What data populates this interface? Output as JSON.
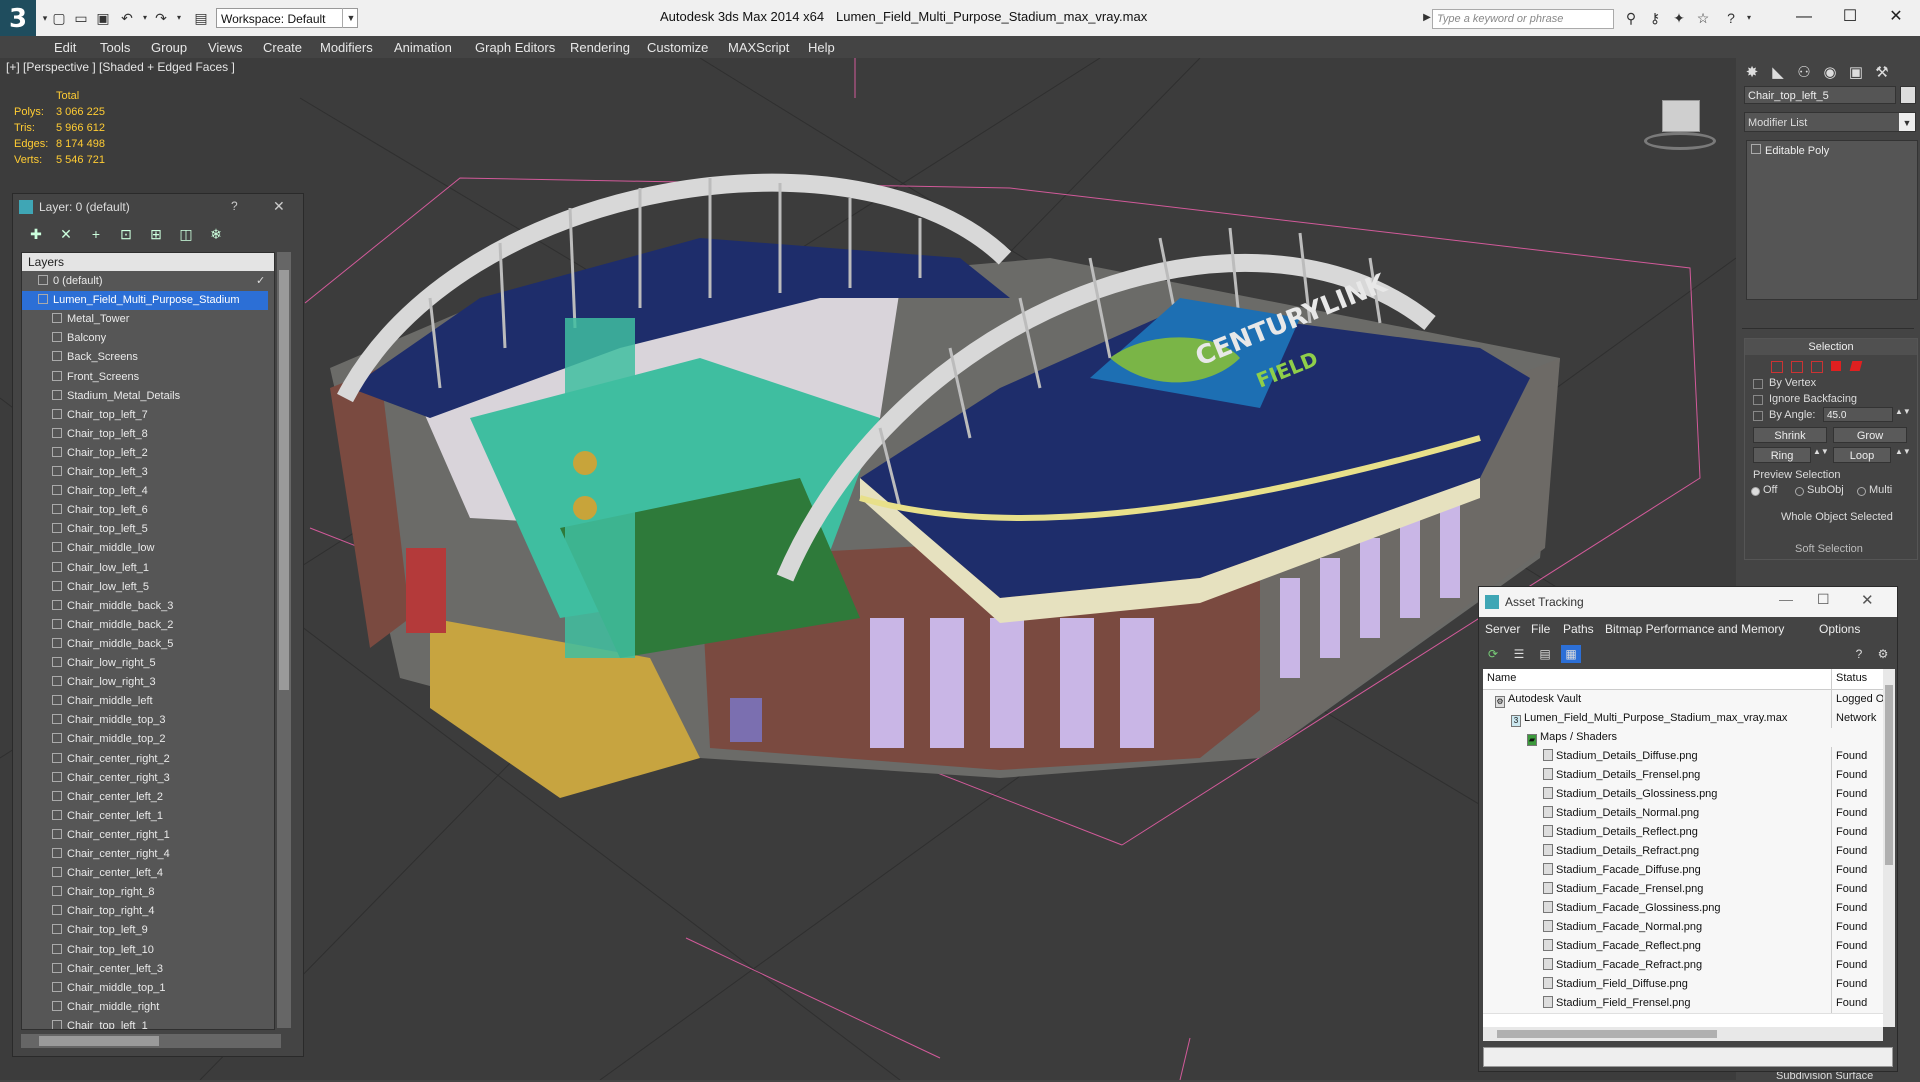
{
  "titlebar": {
    "workspace": "Workspace: Default",
    "app_title": "Autodesk 3ds Max  2014 x64",
    "file_title": "Lumen_Field_Multi_Purpose_Stadium_max_vray.max",
    "search_placeholder": "Type a keyword or phrase"
  },
  "menu": [
    "Edit",
    "Tools",
    "Group",
    "Views",
    "Create",
    "Modifiers",
    "Animation",
    "Graph Editors",
    "Rendering",
    "Customize",
    "MAXScript",
    "Help"
  ],
  "viewport": {
    "label": "[+] [Perspective ] [Shaded + Edged Faces ]",
    "stats": {
      "header": "Total",
      "rows": [
        {
          "label": "Polys:",
          "value": "3 066 225"
        },
        {
          "label": "Tris:",
          "value": "5 966 612"
        },
        {
          "label": "Edges:",
          "value": "8 174 498"
        },
        {
          "label": "Verts:",
          "value": "5 546 721"
        }
      ]
    },
    "logo_text": "CENTURYLINK",
    "logo_sub": "FIELD"
  },
  "layer_panel": {
    "title": "Layer: 0 (default)",
    "help": "?",
    "header": "Layers",
    "rows": [
      {
        "label": "0 (default)",
        "depth": 0
      },
      {
        "label": "Lumen_Field_Multi_Purpose_Stadium",
        "depth": 0,
        "selected": true
      },
      {
        "label": "Metal_Tower",
        "depth": 1
      },
      {
        "label": "Balcony",
        "depth": 1
      },
      {
        "label": "Back_Screens",
        "depth": 1
      },
      {
        "label": "Front_Screens",
        "depth": 1
      },
      {
        "label": "Stadium_Metal_Details",
        "depth": 1
      },
      {
        "label": "Chair_top_left_7",
        "depth": 1
      },
      {
        "label": "Chair_top_left_8",
        "depth": 1
      },
      {
        "label": "Chair_top_left_2",
        "depth": 1
      },
      {
        "label": "Chair_top_left_3",
        "depth": 1
      },
      {
        "label": "Chair_top_left_4",
        "depth": 1
      },
      {
        "label": "Chair_top_left_6",
        "depth": 1
      },
      {
        "label": "Chair_top_left_5",
        "depth": 1
      },
      {
        "label": "Chair_middle_low",
        "depth": 1
      },
      {
        "label": "Chair_low_left_1",
        "depth": 1
      },
      {
        "label": "Chair_low_left_5",
        "depth": 1
      },
      {
        "label": "Chair_middle_back_3",
        "depth": 1
      },
      {
        "label": "Chair_middle_back_2",
        "depth": 1
      },
      {
        "label": "Chair_middle_back_5",
        "depth": 1
      },
      {
        "label": "Chair_low_right_5",
        "depth": 1
      },
      {
        "label": "Chair_low_right_3",
        "depth": 1
      },
      {
        "label": "Chair_middle_left",
        "depth": 1
      },
      {
        "label": "Chair_middle_top_3",
        "depth": 1
      },
      {
        "label": "Chair_middle_top_2",
        "depth": 1
      },
      {
        "label": "Chair_center_right_2",
        "depth": 1
      },
      {
        "label": "Chair_center_right_3",
        "depth": 1
      },
      {
        "label": "Chair_center_left_2",
        "depth": 1
      },
      {
        "label": "Chair_center_left_1",
        "depth": 1
      },
      {
        "label": "Chair_center_right_1",
        "depth": 1
      },
      {
        "label": "Chair_center_right_4",
        "depth": 1
      },
      {
        "label": "Chair_center_left_4",
        "depth": 1
      },
      {
        "label": "Chair_top_right_8",
        "depth": 1
      },
      {
        "label": "Chair_top_right_4",
        "depth": 1
      },
      {
        "label": "Chair_top_left_9",
        "depth": 1
      },
      {
        "label": "Chair_top_left_10",
        "depth": 1
      },
      {
        "label": "Chair_center_left_3",
        "depth": 1
      },
      {
        "label": "Chair_middle_top_1",
        "depth": 1
      },
      {
        "label": "Chair_middle_right",
        "depth": 1
      },
      {
        "label": "Chair_top_left_1",
        "depth": 1
      }
    ]
  },
  "command_panel": {
    "object_name": "Chair_top_left_5",
    "modifier_list": "Modifier List",
    "stack_item": "Editable Poly",
    "selection": {
      "title": "Selection",
      "by_vertex": "By Vertex",
      "ignore_backfacing": "Ignore Backfacing",
      "by_angle": "By Angle:",
      "angle_value": "45.0",
      "shrink": "Shrink",
      "grow": "Grow",
      "ring": "Ring",
      "loop": "Loop",
      "preview_title": "Preview Selection",
      "off": "Off",
      "subobj": "SubObj",
      "multi": "Multi",
      "status": "Whole Object Selected"
    },
    "soft_selection_partial": "Soft Selection",
    "subdivision_surface": "Subdivision Surface"
  },
  "asset_tracking": {
    "title": "Asset Tracking",
    "menu": [
      "Server",
      "File",
      "Paths",
      "Bitmap Performance and Memory",
      "Options"
    ],
    "columns": {
      "name": "Name",
      "status": "Status"
    },
    "rows": [
      {
        "name": "Autodesk Vault",
        "status": "Logged O",
        "indent": 1,
        "icon": "vault"
      },
      {
        "name": "Lumen_Field_Multi_Purpose_Stadium_max_vray.max",
        "status": "Network",
        "indent": 2,
        "icon": "max"
      },
      {
        "name": "Maps / Shaders",
        "status": "",
        "indent": 3,
        "icon": "folder"
      },
      {
        "name": "Stadium_Details_Diffuse.png",
        "status": "Found",
        "indent": 4,
        "icon": "file"
      },
      {
        "name": "Stadium_Details_Frensel.png",
        "status": "Found",
        "indent": 4,
        "icon": "file"
      },
      {
        "name": "Stadium_Details_Glossiness.png",
        "status": "Found",
        "indent": 4,
        "icon": "file"
      },
      {
        "name": "Stadium_Details_Normal.png",
        "status": "Found",
        "indent": 4,
        "icon": "file"
      },
      {
        "name": "Stadium_Details_Reflect.png",
        "status": "Found",
        "indent": 4,
        "icon": "file"
      },
      {
        "name": "Stadium_Details_Refract.png",
        "status": "Found",
        "indent": 4,
        "icon": "file"
      },
      {
        "name": "Stadium_Facade_Diffuse.png",
        "status": "Found",
        "indent": 4,
        "icon": "file"
      },
      {
        "name": "Stadium_Facade_Frensel.png",
        "status": "Found",
        "indent": 4,
        "icon": "file"
      },
      {
        "name": "Stadium_Facade_Glossiness.png",
        "status": "Found",
        "indent": 4,
        "icon": "file"
      },
      {
        "name": "Stadium_Facade_Normal.png",
        "status": "Found",
        "indent": 4,
        "icon": "file"
      },
      {
        "name": "Stadium_Facade_Reflect.png",
        "status": "Found",
        "indent": 4,
        "icon": "file"
      },
      {
        "name": "Stadium_Facade_Refract.png",
        "status": "Found",
        "indent": 4,
        "icon": "file"
      },
      {
        "name": "Stadium_Field_Diffuse.png",
        "status": "Found",
        "indent": 4,
        "icon": "file"
      },
      {
        "name": "Stadium_Field_Frensel.png",
        "status": "Found",
        "indent": 4,
        "icon": "file"
      }
    ]
  }
}
